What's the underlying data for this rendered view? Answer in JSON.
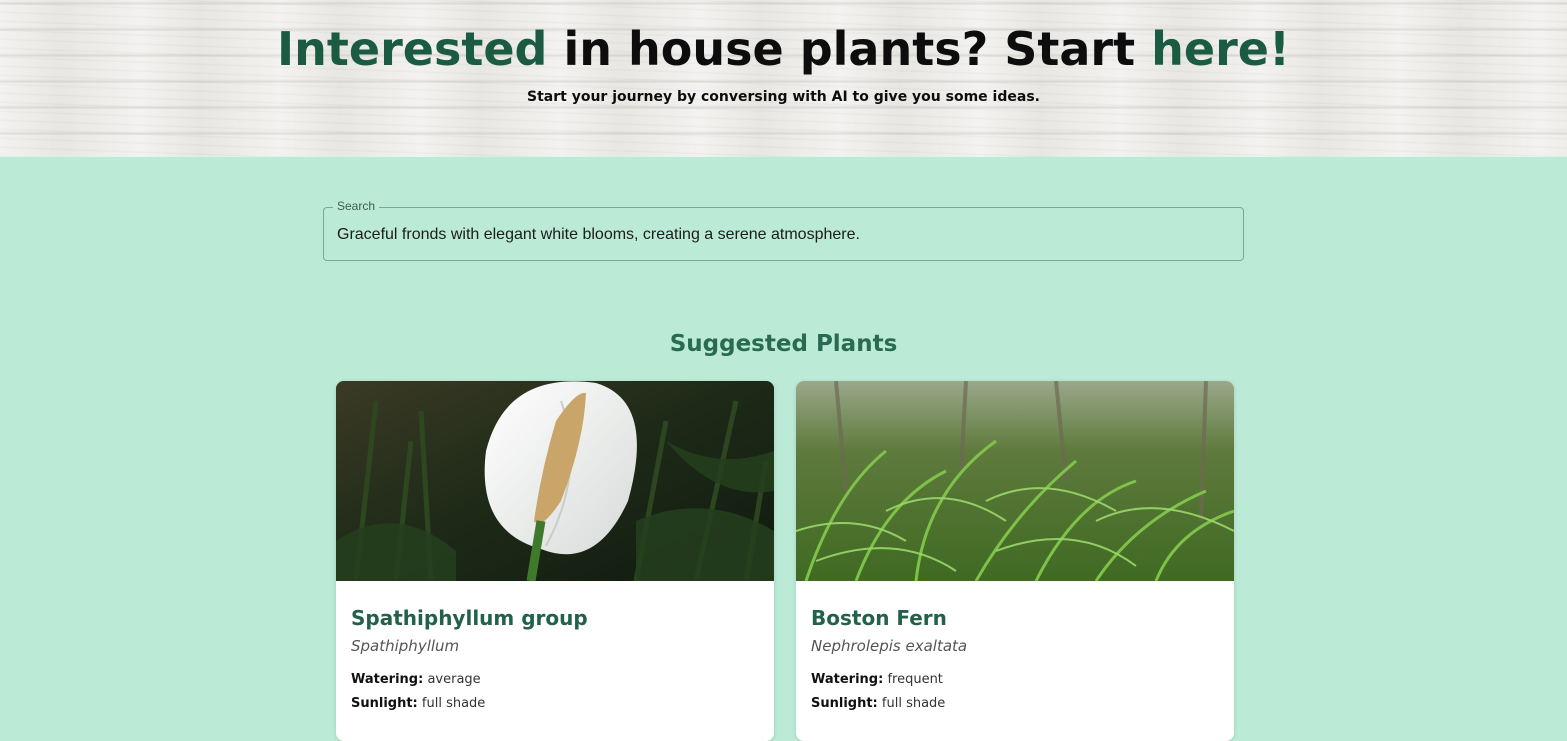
{
  "hero": {
    "title_accent_1": "Interested",
    "title_middle": " in house plants? Start ",
    "title_accent_2": "here!",
    "subtitle": "Start your journey by conversing with AI to give you some ideas."
  },
  "search": {
    "label": "Search",
    "value": "Graceful fronds with elegant white blooms, creating a serene atmosphere."
  },
  "suggested": {
    "title": "Suggested Plants",
    "plants": [
      {
        "name": "Spathiphyllum group",
        "scientific": "Spathiphyllum",
        "watering_label": "Watering:",
        "watering": " average",
        "sunlight_label": "Sunlight:",
        "sunlight": " full shade",
        "image": "peace-lily-photo"
      },
      {
        "name": "Boston Fern",
        "scientific": "Nephrolepis exaltata",
        "watering_label": "Watering:",
        "watering": " frequent",
        "sunlight_label": "Sunlight:",
        "sunlight": " full shade",
        "image": "fern-photo"
      }
    ]
  },
  "colors": {
    "page_background": "#bbead6",
    "accent_green": "#1b5a43",
    "heading_green": "#2a6a52"
  }
}
